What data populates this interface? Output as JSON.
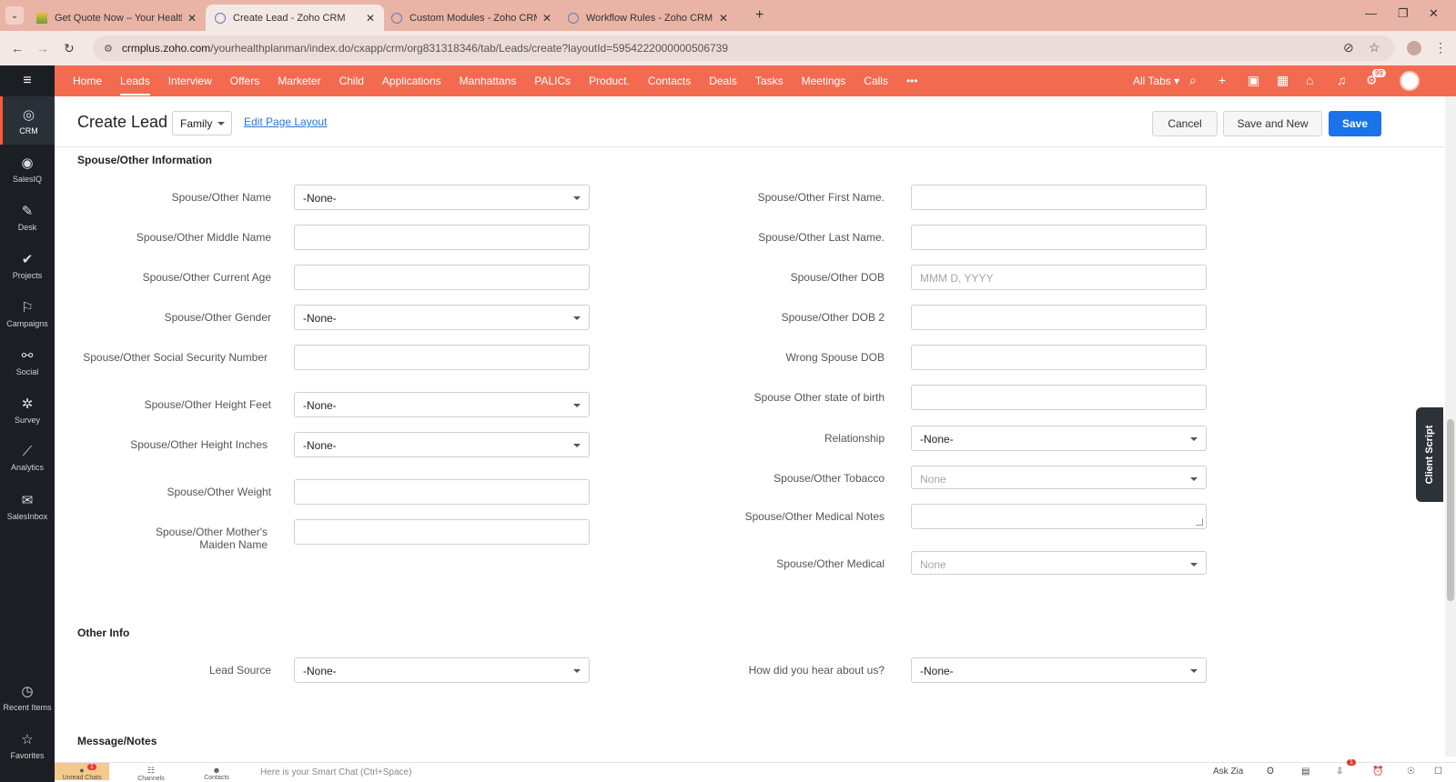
{
  "browser": {
    "tabs": [
      {
        "title": "Get Quote Now – Your Health Pla"
      },
      {
        "title": "Create Lead - Zoho CRM"
      },
      {
        "title": "Custom Modules - Zoho CRM"
      },
      {
        "title": "Workflow Rules - Zoho CRM"
      }
    ],
    "url_host": "crmplus.zoho.com",
    "url_path": "/yourhealthplanman/index.do/cxapp/crm/org831318346/tab/Leads/create?layoutId=5954222000000506739"
  },
  "appnav": {
    "items": [
      {
        "label": "CRM",
        "icon": "crm-icon"
      },
      {
        "label": "SalesIQ",
        "icon": "salesiq-icon"
      },
      {
        "label": "Desk",
        "icon": "desk-icon"
      },
      {
        "label": "Projects",
        "icon": "projects-icon"
      },
      {
        "label": "Campaigns",
        "icon": "campaigns-icon"
      },
      {
        "label": "Social",
        "icon": "social-icon"
      },
      {
        "label": "Survey",
        "icon": "survey-icon"
      },
      {
        "label": "Analytics",
        "icon": "analytics-icon"
      },
      {
        "label": "SalesInbox",
        "icon": "salesinbox-icon"
      }
    ],
    "bottom": [
      {
        "label": "Recent Items",
        "icon": "clock-icon"
      },
      {
        "label": "Favorites",
        "icon": "star-icon"
      }
    ]
  },
  "topnav": {
    "items": [
      "Home",
      "Leads",
      "Interview",
      "Offers",
      "Marketer",
      "Child",
      "Applications",
      "Manhattans",
      "PALICs",
      "Product.",
      "Contacts",
      "Deals",
      "Tasks",
      "Meetings",
      "Calls"
    ],
    "more": "•••",
    "all_tabs": "All Tabs",
    "notif_count": "99",
    "accent": "#f26b50"
  },
  "header": {
    "title": "Create Lead",
    "layout": "Family",
    "edit_layout": "Edit Page Layout",
    "cancel": "Cancel",
    "save_and_new": "Save and New",
    "save": "Save"
  },
  "sections": {
    "spouse_title": "Spouse/Other Information",
    "other_title": "Other Info",
    "notes_title": "Message/Notes"
  },
  "left_fields": [
    {
      "label": "Spouse/Other Name",
      "value": "-None-",
      "type": "select"
    },
    {
      "label": "Spouse/Other Middle Name",
      "value": "",
      "type": "text"
    },
    {
      "label": "Spouse/Other Current Age",
      "value": "",
      "type": "text"
    },
    {
      "label": "Spouse/Other Gender",
      "value": "-None-",
      "type": "select"
    },
    {
      "label": "Spouse/Other Social Security Number",
      "value": "",
      "type": "text"
    },
    {
      "label": "Spouse/Other Height Feet",
      "value": "-None-",
      "type": "select"
    },
    {
      "label": "Spouse/Other Height Inches",
      "value": "-None-",
      "type": "select"
    },
    {
      "label": "Spouse/Other Weight",
      "value": "",
      "type": "text"
    },
    {
      "label": "Spouse/Other Mother's Maiden Name",
      "value": "",
      "type": "text"
    }
  ],
  "right_fields": [
    {
      "label": "Spouse/Other First Name.",
      "value": "",
      "type": "text"
    },
    {
      "label": "Spouse/Other Last Name.",
      "value": "",
      "type": "text"
    },
    {
      "label": "Spouse/Other DOB",
      "value": "",
      "placeholder": "MMM D, YYYY",
      "type": "date"
    },
    {
      "label": "Spouse/Other DOB 2",
      "value": "",
      "type": "text"
    },
    {
      "label": "Wrong Spouse DOB",
      "value": "",
      "type": "text"
    },
    {
      "label": "Spouse Other state of birth",
      "value": "",
      "type": "text"
    },
    {
      "label": "Relationship",
      "value": "-None-",
      "type": "select"
    },
    {
      "label": "Spouse/Other Tobacco",
      "value": "None",
      "type": "select-disabled"
    },
    {
      "label": "Spouse/Other Medical Notes",
      "value": "",
      "type": "textarea"
    },
    {
      "label": "Spouse/Other Medical",
      "value": "None",
      "type": "select-disabled"
    }
  ],
  "other_info": {
    "lead_source_label": "Lead Source",
    "lead_source_value": "-None-",
    "hear_label": "How did you hear about us?",
    "hear_value": "-None-"
  },
  "client_script": "Client Script",
  "bottombar": {
    "unread_chats": "Unread Chats",
    "channels": "Channels",
    "contacts": "Contacts",
    "smart_chat": "Here is your Smart Chat (Ctrl+Space)",
    "ask_zia": "Ask Zia",
    "chat_badge": "1",
    "download_badge": "1"
  }
}
